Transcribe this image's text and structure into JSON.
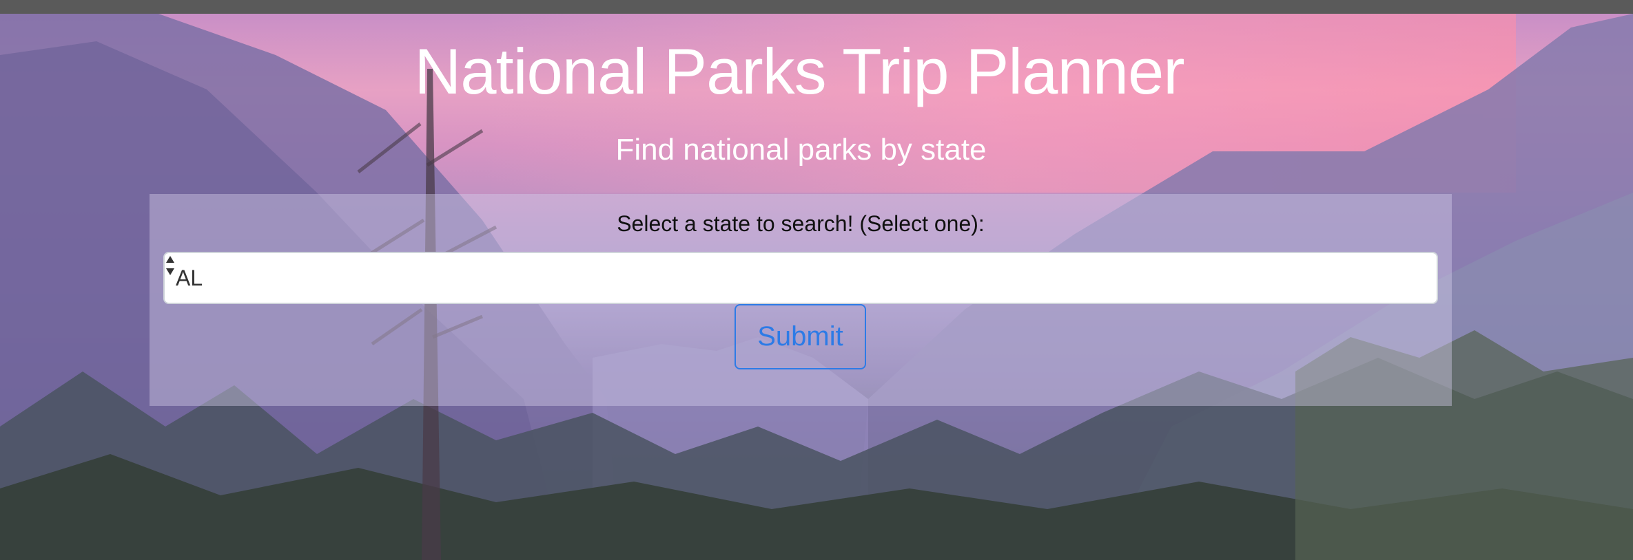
{
  "header": {
    "title": "National Parks Trip Planner",
    "subtitle": "Find national parks by state"
  },
  "search_form": {
    "label": "Select a state to search! (Select one):",
    "selected_state": "AL",
    "submit_label": "Submit"
  },
  "colors": {
    "accent": "#2d7be6",
    "text_light": "#ffffff",
    "panel_tint": "#d7d0eb"
  },
  "icons": {
    "select_arrows": "chevron-up-down-icon"
  }
}
